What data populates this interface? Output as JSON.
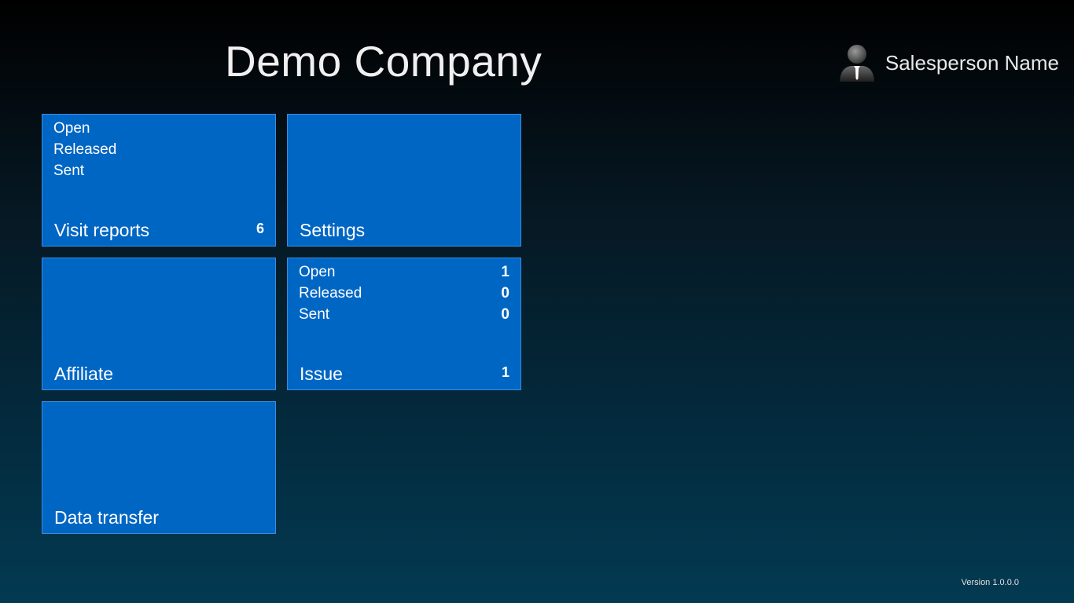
{
  "header": {
    "company": "Demo Company",
    "user_name": "Salesperson Name",
    "avatar_icon": "user-avatar-icon"
  },
  "tiles": {
    "visit_reports": {
      "label": "Visit reports",
      "count": "6",
      "statuses": [
        {
          "label": "Open",
          "count": ""
        },
        {
          "label": "Released",
          "count": ""
        },
        {
          "label": "Sent",
          "count": ""
        }
      ]
    },
    "settings": {
      "label": "Settings"
    },
    "affiliate": {
      "label": "Affiliate"
    },
    "issue": {
      "label": "Issue",
      "count": "1",
      "statuses": [
        {
          "label": "Open",
          "count": "1"
        },
        {
          "label": "Released",
          "count": "0"
        },
        {
          "label": "Sent",
          "count": "0"
        }
      ]
    },
    "data_transfer": {
      "label": "Data transfer"
    }
  },
  "footer": {
    "version": "Version 1.0.0.0"
  },
  "colors": {
    "tile": "#0066c4",
    "tile_border": "#3a8ce0"
  }
}
